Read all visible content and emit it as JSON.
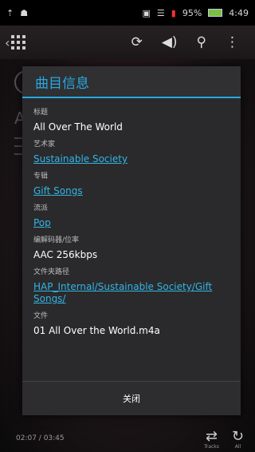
{
  "status_bar": {
    "battery": "95%",
    "time": "4:49"
  },
  "player": {
    "time_display": "02:07 / 03:45",
    "bottom_left_label": "Tracks",
    "bottom_right_label": "All",
    "bg_letter": "A"
  },
  "dialog": {
    "title": "曲目信息",
    "fields": [
      {
        "label": "标题",
        "value": "All Over The World"
      },
      {
        "label": "艺术家",
        "value": "Sustainable Society"
      },
      {
        "label": "专辑",
        "value": "Gift Songs"
      },
      {
        "label": "流派",
        "value": "Pop"
      },
      {
        "label": "编解码器/位率",
        "value": "AAC 256kbps"
      },
      {
        "label": "文件夹路径",
        "value": "HAP_Internal/Sustainable Society/Gift Songs/"
      },
      {
        "label": "文件",
        "value": "01 All Over the World.m4a"
      }
    ],
    "close_label": "关闭"
  }
}
